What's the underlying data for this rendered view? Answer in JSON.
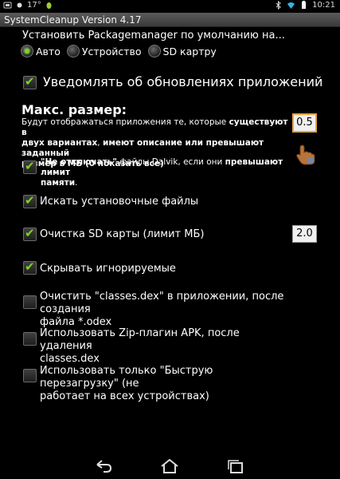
{
  "statusbar": {
    "temperature": "17°",
    "time": "10:21"
  },
  "window_title": "SystemCleanup Version 4.17",
  "package_manager": {
    "label": "Установить Packagemanager по умолчанию на...",
    "options": [
      {
        "label": "Авто",
        "selected": true
      },
      {
        "label": "Устройство",
        "selected": false
      },
      {
        "label": "SD картру",
        "selected": false
      }
    ]
  },
  "notify_updates": {
    "label": "Уведомлять об обновлениях приложений",
    "checked": true
  },
  "max_size": {
    "title": "Макс. размер:",
    "desc_1": "Будут отображаться приложения те, которые ",
    "desc_1_bold": "существуют в",
    "desc_2_bold": "двух вариантах",
    "desc_2": ", ",
    "desc_2b_bold": "имеют описание или превышают заданный",
    "desc_3_bold": "размер в МБ (0 показать все)",
    "value": "0.5"
  },
  "dalvik": {
    "quote": "\"Не отключать\"",
    "text_1": " файлы Dalvik, если они ",
    "text_1_bold": "превышают лимит",
    "text_2_bold": "памяти",
    "text_2": ".",
    "checked": true
  },
  "settings": [
    {
      "label": "Искать установочные файлы",
      "checked": true
    },
    {
      "label": "Очистка SD карты (лимит МБ)",
      "checked": true,
      "value": "2.0"
    },
    {
      "label": "Скрывать игнорируемые",
      "checked": true
    },
    {
      "label": "Очистить \"classes.dex\" в приложении, после создания",
      "label2": "файла *.odex",
      "checked": false
    },
    {
      "label": "Использовать Zip-плагин APK, после удаления",
      "label2": "classes.dex",
      "checked": false
    },
    {
      "label": "Использовать только \"Быструю перезагрузку\" (не",
      "label2": "работает на всех устройствах)",
      "checked": false
    }
  ],
  "colors": {
    "accent_check": "#7ed321",
    "highlight_box": "#e8a33a"
  },
  "icons": [
    "notification-icon",
    "weather-icon",
    "bug-icon",
    "bluetooth-icon",
    "wifi-icon",
    "battery-icon",
    "hand-cursor-icon",
    "back-icon",
    "home-icon",
    "recent-apps-icon"
  ]
}
